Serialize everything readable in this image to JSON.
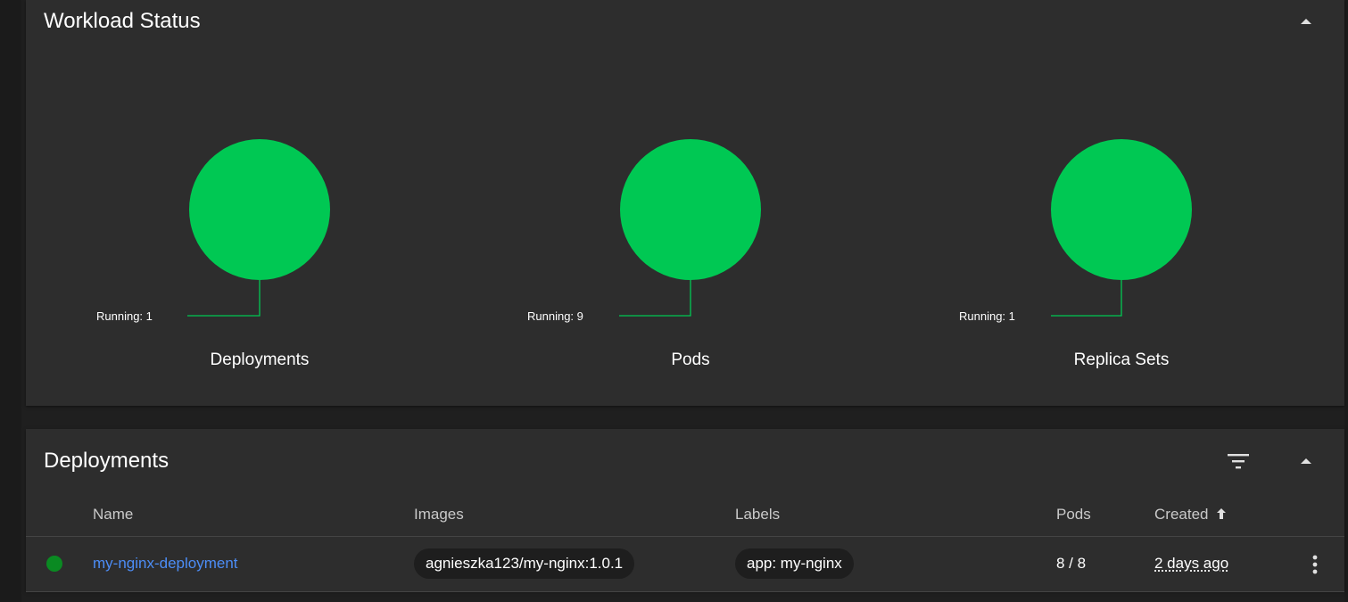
{
  "workload": {
    "title": "Workload Status",
    "charts": [
      {
        "name": "Deployments",
        "label": "Running: 1",
        "running": 1
      },
      {
        "name": "Pods",
        "label": "Running: 9",
        "running": 9
      },
      {
        "name": "Replica Sets",
        "label": "Running: 1",
        "running": 1
      }
    ]
  },
  "deployments": {
    "title": "Deployments",
    "columns": [
      "Name",
      "Images",
      "Labels",
      "Pods",
      "Created"
    ],
    "sort_icon": "arrow-up-icon",
    "rows": [
      {
        "status_color": "#0a8a22",
        "name": "my-nginx-deployment",
        "image": "agnieszka123/my-nginx:1.0.1",
        "label": "app: my-nginx",
        "pods": "8 / 8",
        "created": "2 days ago"
      }
    ]
  },
  "colors": {
    "running": "#00c853",
    "background": "#2d2d2d",
    "link": "#4c8df6"
  }
}
